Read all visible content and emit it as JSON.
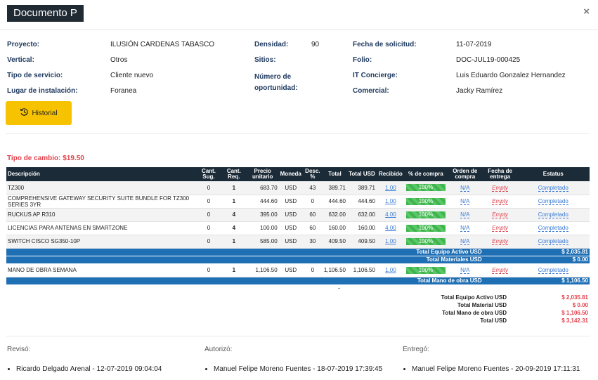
{
  "window": {
    "title": "Documento P",
    "close_glyph": "×"
  },
  "info": {
    "proyecto": {
      "label": "Proyecto:",
      "value": "ILUSIÓN CARDENAS TABASCO"
    },
    "vertical": {
      "label": "Vertical:",
      "value": "Otros"
    },
    "tipo_servicio": {
      "label": "Tipo de servicio:",
      "value": "Cliente nuevo"
    },
    "lugar": {
      "label": "Lugar de instalación:",
      "value": "Foranea"
    },
    "densidad": {
      "label": "Densidad:",
      "value": "90"
    },
    "sitios": {
      "label": "Sitios:",
      "value": ""
    },
    "oportunidad": {
      "label": "Número de oportunidad:",
      "value": ""
    },
    "fecha_solicitud": {
      "label": "Fecha de solicitud:",
      "value": "11-07-2019"
    },
    "folio": {
      "label": "Folio:",
      "value": "DOC-JUL19-000425"
    },
    "it_concierge": {
      "label": "IT Concierge:",
      "value": "Luis Eduardo Gonzalez Hernandez"
    },
    "comercial": {
      "label": "Comercial:",
      "value": "Jacky Ramírez"
    }
  },
  "historial_button": {
    "label": "Historial",
    "icon": "history-icon"
  },
  "tipo_cambio": "Tipo de cambio: $19.50",
  "table": {
    "headers": [
      "Descripción",
      "Cant. Sug.",
      "Cant. Req.",
      "Precio unitario",
      "Moneda",
      "Desc. %",
      "Total",
      "Total USD",
      "Recibido",
      "% de compra",
      "Orden de compra",
      "Fecha de entrega",
      "Estatus"
    ],
    "rows": [
      {
        "desc": "TZ300",
        "sug": "0",
        "req": "1",
        "precio": "683.70",
        "moneda": "USD",
        "descu": "43",
        "total": "389.71",
        "total_usd": "389.71",
        "recibido": "1.00",
        "compra": "100%",
        "orden": "N/A",
        "fecha": "Empty",
        "estatus": "Completado"
      },
      {
        "desc": "COMPREHENSIVE GATEWAY SECURITY SUITE BUNDLE FOR TZ300 SERIES 3YR",
        "sug": "0",
        "req": "1",
        "precio": "444.60",
        "moneda": "USD",
        "descu": "0",
        "total": "444.60",
        "total_usd": "444.60",
        "recibido": "1.00",
        "compra": "100%",
        "orden": "N/A",
        "fecha": "Empty",
        "estatus": "Completado"
      },
      {
        "desc": "RUCKUS AP R310",
        "sug": "0",
        "req": "4",
        "precio": "395.00",
        "moneda": "USD",
        "descu": "60",
        "total": "632.00",
        "total_usd": "632.00",
        "recibido": "4.00",
        "compra": "100%",
        "orden": "N/A",
        "fecha": "Empty",
        "estatus": "Completado"
      },
      {
        "desc": "LICENCIAS PARA ANTENAS EN SMARTZONE",
        "sug": "0",
        "req": "4",
        "precio": "100.00",
        "moneda": "USD",
        "descu": "60",
        "total": "160.00",
        "total_usd": "160.00",
        "recibido": "4.00",
        "compra": "100%",
        "orden": "N/A",
        "fecha": "Empty",
        "estatus": "Completado"
      },
      {
        "desc": "SWITCH CISCO SG350-10P",
        "sug": "0",
        "req": "1",
        "precio": "585.00",
        "moneda": "USD",
        "descu": "30",
        "total": "409.50",
        "total_usd": "409.50",
        "recibido": "1.00",
        "compra": "100%",
        "orden": "N/A",
        "fecha": "Empty",
        "estatus": "Completado"
      }
    ],
    "total_equipo": {
      "label": "Total Equipo Activo USD",
      "value": "$ 2,035.81"
    },
    "total_materiales": {
      "label": "Total Materiales USD",
      "value": "$ 0.00"
    },
    "mano_obra_row": {
      "desc": "MANO DE OBRA SEMANA",
      "sug": "0",
      "req": "1",
      "precio": "1,106.50",
      "moneda": "USD",
      "descu": "0",
      "total": "1,106.50",
      "total_usd": "1,106.50",
      "recibido": "1.00",
      "compra": "100%",
      "orden": "N/A",
      "fecha": "Empty",
      "estatus": "Completado"
    },
    "total_mano_obra": {
      "label": "Total Mano de obra USD",
      "value": "$ 1,106.50"
    }
  },
  "dash": "-",
  "summary": [
    {
      "label": "Total Equipo Activo USD",
      "value": "$ 2,035.81"
    },
    {
      "label": "Total Material USD",
      "value": "$ 0.00"
    },
    {
      "label": "Total Mano de obra USD",
      "value": "$ 1,106.50"
    },
    {
      "label": "Total USD",
      "value": "$ 3,142.31"
    }
  ],
  "signatures": {
    "reviso": {
      "label": "Revisó:",
      "value": "Ricardo Delgado Arenal - 12-07-2019 09:04:04"
    },
    "autorizo": {
      "label": "Autorizó:",
      "value": "Manuel Felipe Moreno Fuentes - 18-07-2019 17:39:45"
    },
    "entrego": {
      "label": "Entregó:",
      "value": "Manuel Felipe Moreno Fuentes - 20-09-2019 17:11:31"
    }
  },
  "colors": {
    "header_dark": "#1c2b38",
    "accent_yellow": "#f7c300",
    "total_blue": "#1f6fb5",
    "red": "#e0414b",
    "green": "#3db54a"
  }
}
